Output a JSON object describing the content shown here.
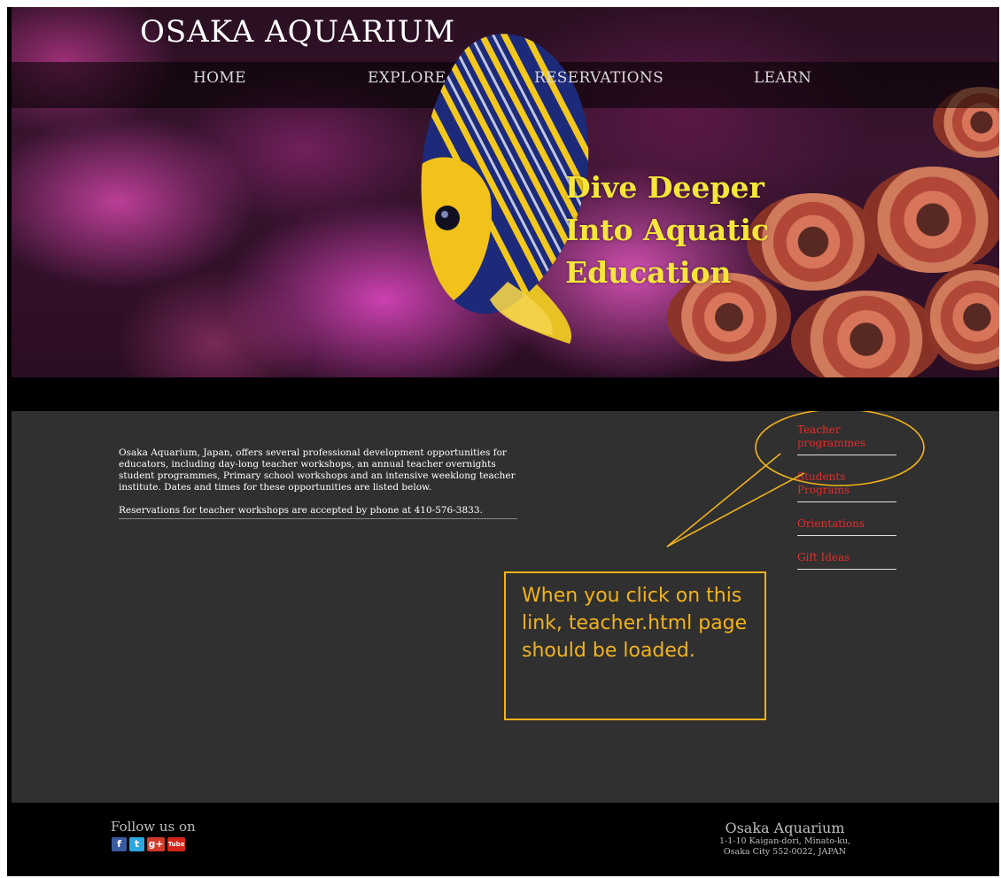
{
  "site": {
    "title": "OSAKA AQUARIUM"
  },
  "nav": {
    "items": [
      {
        "label": "HOME"
      },
      {
        "label": "EXPLORE"
      },
      {
        "label": "RESERVATIONS"
      },
      {
        "label": "LEARN"
      }
    ]
  },
  "hero": {
    "tagline_lines": [
      "Dive Deeper",
      "Into Aquatic",
      "Education"
    ]
  },
  "content": {
    "paragraphs": [
      "Osaka Aquarium, Japan, offers several professional development opportunities for educators, including day-long teacher workshops, an annual teacher overnights student programmes, Primary school workshops and an intensive weeklong teacher institute. Dates and times for these opportunities are listed below.",
      "Reservations for teacher workshops are accepted by phone at 410-576-3833."
    ]
  },
  "side_links": [
    {
      "label": "Teacher programmes"
    },
    {
      "label": "Students Programs"
    },
    {
      "label": "Orientations"
    },
    {
      "label": "Gift Ideas"
    }
  ],
  "callout": {
    "text": "When you click on this link, teacher.html page should be loaded.",
    "color": "#f2b21b"
  },
  "footer": {
    "follow_label": "Follow us on",
    "social_icons": [
      {
        "name": "facebook-icon",
        "glyph": "f"
      },
      {
        "name": "twitter-icon",
        "glyph": "t"
      },
      {
        "name": "google-plus-icon",
        "glyph": "g+"
      },
      {
        "name": "youtube-icon",
        "glyph": "Tube"
      }
    ],
    "address": {
      "name": "Osaka Aquarium",
      "line1": "1-1-10 Kaigan-dori, Minato-ku,",
      "line2": "Osaka City 552-0022, JAPAN"
    }
  },
  "colors": {
    "accent_link": "#e52b2b",
    "tagline": "#f6e53a",
    "content_bg": "#303030"
  }
}
